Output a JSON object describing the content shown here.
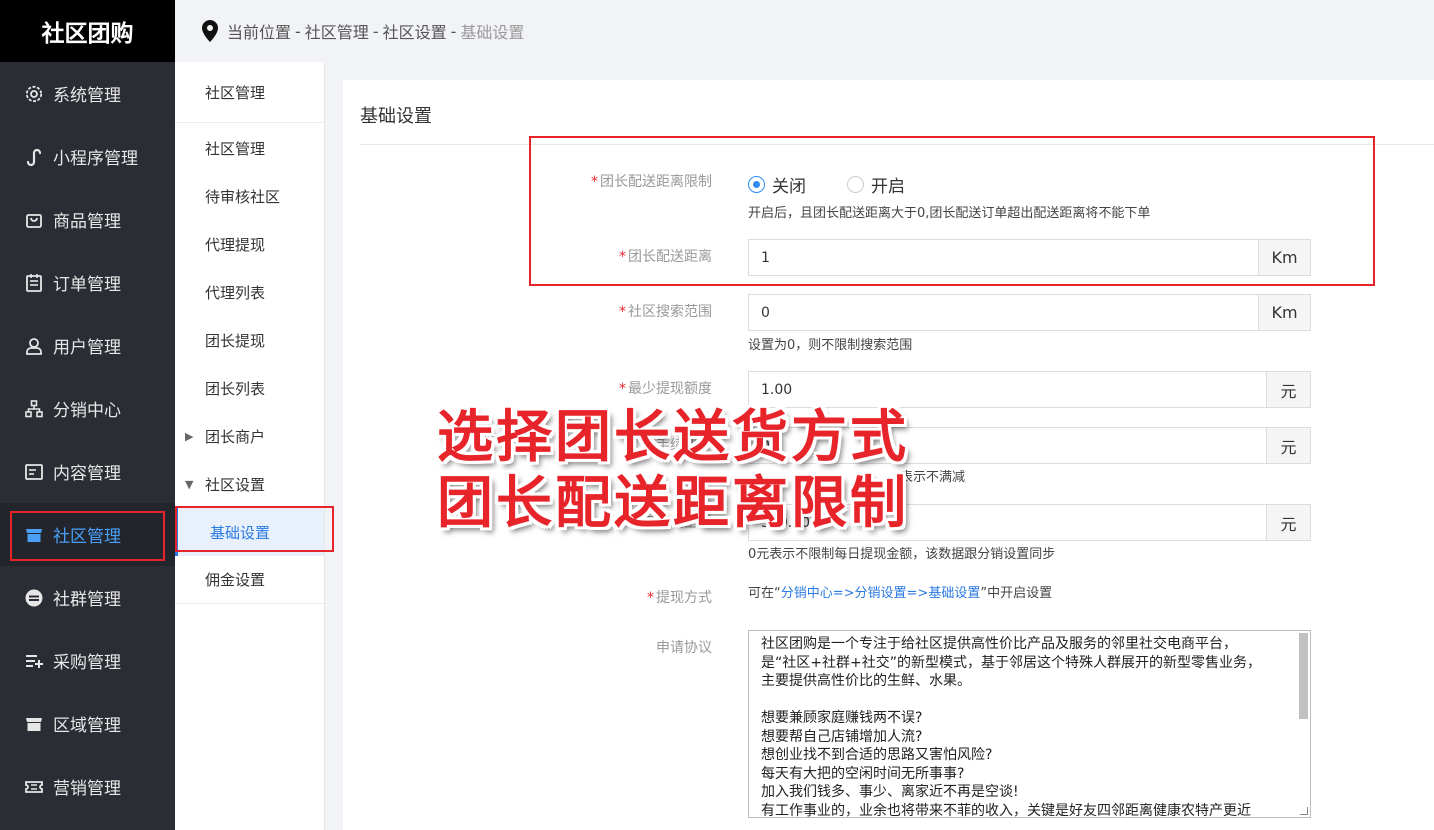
{
  "brand": "社区团购",
  "sidebar": {
    "items": [
      {
        "label": "系统管理",
        "icon": "gear-icon"
      },
      {
        "label": "小程序管理",
        "icon": "miniapp-icon"
      },
      {
        "label": "商品管理",
        "icon": "bag-icon"
      },
      {
        "label": "订单管理",
        "icon": "order-icon"
      },
      {
        "label": "用户管理",
        "icon": "user-icon"
      },
      {
        "label": "分销中心",
        "icon": "hierarchy-icon"
      },
      {
        "label": "内容管理",
        "icon": "content-icon"
      },
      {
        "label": "社区管理",
        "icon": "store-icon"
      },
      {
        "label": "社群管理",
        "icon": "minus-circle-icon"
      },
      {
        "label": "采购管理",
        "icon": "list-plus-icon"
      },
      {
        "label": "区域管理",
        "icon": "store-icon"
      },
      {
        "label": "营销管理",
        "icon": "ticket-icon"
      }
    ],
    "active": "社区管理"
  },
  "breadcrumb": {
    "prefix": "当前位置",
    "items": [
      "社区管理",
      "社区设置",
      "基础设置"
    ]
  },
  "submenu": {
    "head": "社区管理",
    "items": [
      "社区管理",
      "待审核社区",
      "代理提现",
      "代理列表",
      "团长提现",
      "团长列表",
      "团长商户",
      "社区设置",
      "基础设置",
      "佣金设置"
    ],
    "active": "基础设置"
  },
  "content": {
    "title": "基础设置",
    "distance_limit": {
      "label": "团长配送距离限制",
      "options": [
        "关闭",
        "开启"
      ],
      "selected": "关闭",
      "hint": "开启后，且团长配送距离大于0,团长配送订单超出配送距离将不能下单"
    },
    "distance": {
      "label": "团长配送距离",
      "value": "1",
      "unit": "Km"
    },
    "search_range": {
      "label": "社区搜索范围",
      "value": "0",
      "unit": "Km",
      "hint": "设置为0，则不限制搜索范围"
    },
    "min_withdraw": {
      "label": "最少提现额度",
      "value": "1.00",
      "unit": "元"
    },
    "fee_row": {
      "label": "手续费率",
      "value": "0",
      "unit": "元",
      "hint": "表示不满减"
    },
    "daily_limit": {
      "label": "每日提现上限",
      "value": "300.00",
      "unit": "元",
      "hint": "0元表示不限制每日提现金额，该数据跟分销设置同步"
    },
    "withdraw_method": {
      "label": "提现方式",
      "hint_prefix": "可在“",
      "hint_link": "分销中心=>分销设置=>基础设置",
      "hint_suffix": "”中开启设置"
    },
    "agreement": {
      "label": "申请协议",
      "lines": [
        "社区团购是一个专注于给社区提供高性价比产品及服务的邻里社交电商平台，",
        "是“社区+社群+社交”的新型模式，基于邻居这个特殊人群展开的新型零售业务，",
        "主要提供高性价比的生鲜、水果。",
        "",
        "想要兼顾家庭赚钱两不误?",
        "想要帮自己店铺增加人流?",
        "想创业找不到合适的思路又害怕风险?",
        "每天有大把的空闲时间无所事事?",
        "加入我们钱多、事少、离家近不再是空谈!",
        "有工作事业的，业余也将带来不菲的收入，关键是好友四邻距离健康农特产更近"
      ]
    }
  },
  "overlay": {
    "line1": "选择团长送货方式",
    "line2": "团长配送距离限制"
  },
  "colors": {
    "accent": "#2a8cf0",
    "highlight_red": "#e8242b",
    "sidebar_bg": "#2a2d34"
  }
}
